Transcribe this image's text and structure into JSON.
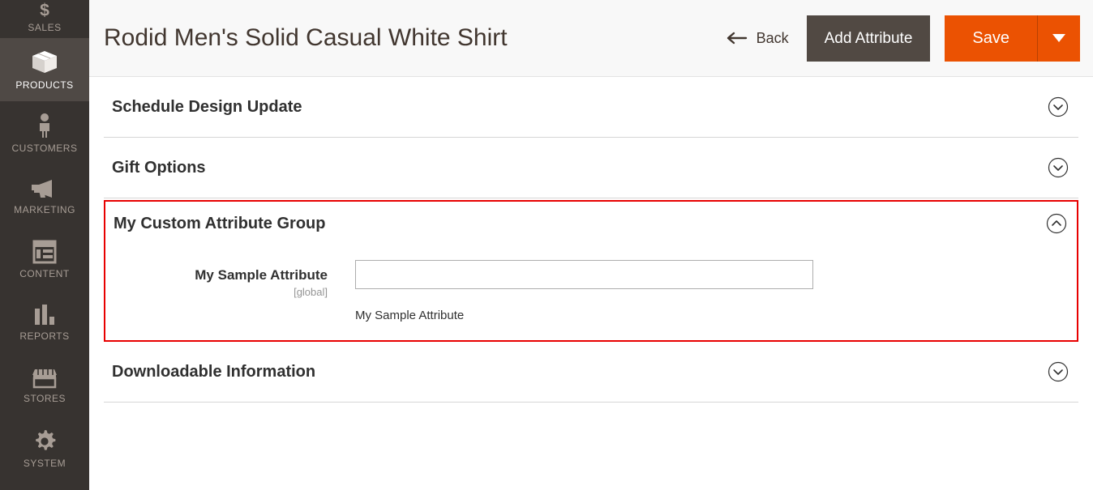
{
  "sidebar": {
    "items": [
      {
        "label": "SALES",
        "icon": "dollar-icon",
        "active": false,
        "partial": true
      },
      {
        "label": "PRODUCTS",
        "icon": "box-icon",
        "active": true,
        "partial": false
      },
      {
        "label": "CUSTOMERS",
        "icon": "person-icon",
        "active": false,
        "partial": false
      },
      {
        "label": "MARKETING",
        "icon": "megaphone-icon",
        "active": false,
        "partial": false
      },
      {
        "label": "CONTENT",
        "icon": "layout-icon",
        "active": false,
        "partial": false
      },
      {
        "label": "REPORTS",
        "icon": "bar-chart-icon",
        "active": false,
        "partial": false
      },
      {
        "label": "STORES",
        "icon": "storefront-icon",
        "active": false,
        "partial": false
      },
      {
        "label": "SYSTEM",
        "icon": "gear-icon",
        "active": false,
        "partial": false
      }
    ]
  },
  "header": {
    "title": "Rodid Men's Solid Casual White Shirt",
    "back_label": "Back",
    "add_attribute_label": "Add Attribute",
    "save_label": "Save",
    "save_toggle_icon": "caret-down-icon",
    "back_icon": "arrow-left-icon"
  },
  "sections": [
    {
      "title": "Schedule Design Update",
      "expanded": false,
      "toggle_icon": "chevron-down-icon",
      "highlighted": false
    },
    {
      "title": "Gift Options",
      "expanded": false,
      "toggle_icon": "chevron-down-icon",
      "highlighted": false
    },
    {
      "title": "My Custom Attribute Group",
      "expanded": true,
      "toggle_icon": "chevron-up-icon",
      "highlighted": true,
      "field": {
        "label": "My Sample Attribute",
        "scope": "[global]",
        "value": "",
        "placeholder": "",
        "note": "My Sample Attribute"
      }
    },
    {
      "title": "Downloadable Information",
      "expanded": false,
      "toggle_icon": "chevron-down-icon",
      "highlighted": false
    }
  ],
  "colors": {
    "sidebar_bg": "#373330",
    "sidebar_active_bg": "#4f4945",
    "accent_orange": "#eb5202",
    "secondary_button": "#514943",
    "highlight_border": "#e80000",
    "header_bg": "#f8f8f8"
  }
}
